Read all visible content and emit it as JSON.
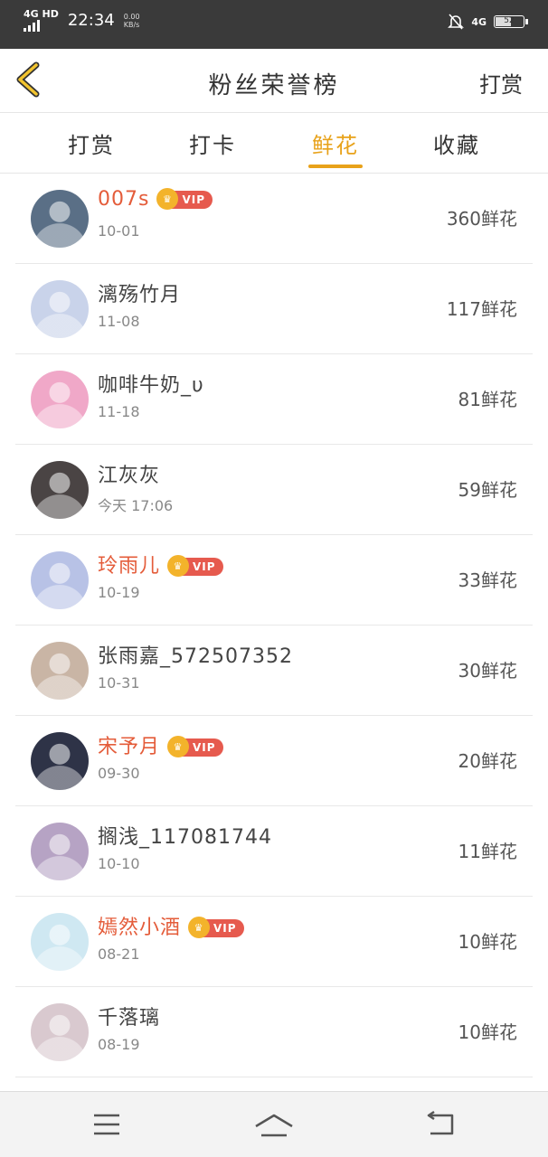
{
  "status_bar": {
    "network": "4G HD",
    "time": "22:34",
    "speed_value": "0.00",
    "speed_unit": "KB/s",
    "network_right": "4G",
    "battery": "52"
  },
  "header": {
    "title": "粉丝荣誉榜",
    "right_action": "打赏"
  },
  "tabs": [
    {
      "label": "打赏"
    },
    {
      "label": "打卡"
    },
    {
      "label": "鲜花"
    },
    {
      "label": "收藏"
    }
  ],
  "vip_label": "VIP",
  "fans": [
    {
      "name": "007s",
      "date": "10-01",
      "amount": "360鲜花",
      "vip": true,
      "avatar_color": "#5a6f86"
    },
    {
      "name": "漓殇竹月",
      "date": "11-08",
      "amount": "117鲜花",
      "vip": false,
      "avatar_color": "#c9d3ea"
    },
    {
      "name": "咖啡牛奶_υ",
      "date": "11-18",
      "amount": "81鲜花",
      "vip": false,
      "avatar_color": "#f0a8c8"
    },
    {
      "name": "江灰灰",
      "date": "今天 17:06",
      "amount": "59鲜花",
      "vip": false,
      "avatar_color": "#4a4444"
    },
    {
      "name": "玲雨儿",
      "date": "10-19",
      "amount": "33鲜花",
      "vip": true,
      "avatar_color": "#b8c2e6"
    },
    {
      "name": "张雨嘉_572507352",
      "date": "10-31",
      "amount": "30鲜花",
      "vip": false,
      "avatar_color": "#c9b5a5"
    },
    {
      "name": "宋予月",
      "date": "09-30",
      "amount": "20鲜花",
      "vip": true,
      "avatar_color": "#2e3347"
    },
    {
      "name": "搁浅_117081744",
      "date": "10-10",
      "amount": "11鲜花",
      "vip": false,
      "avatar_color": "#b6a3c4"
    },
    {
      "name": "嫣然小酒",
      "date": "08-21",
      "amount": "10鲜花",
      "vip": true,
      "avatar_color": "#cfe8f2"
    },
    {
      "name": "千落璃",
      "date": "08-19",
      "amount": "10鲜花",
      "vip": false,
      "avatar_color": "#d9c9cf"
    }
  ],
  "colors": {
    "accent": "#e8a21a",
    "vip_name": "#e45c3a",
    "vip_badge": "#e65a4e",
    "crown": "#f3b32b"
  }
}
